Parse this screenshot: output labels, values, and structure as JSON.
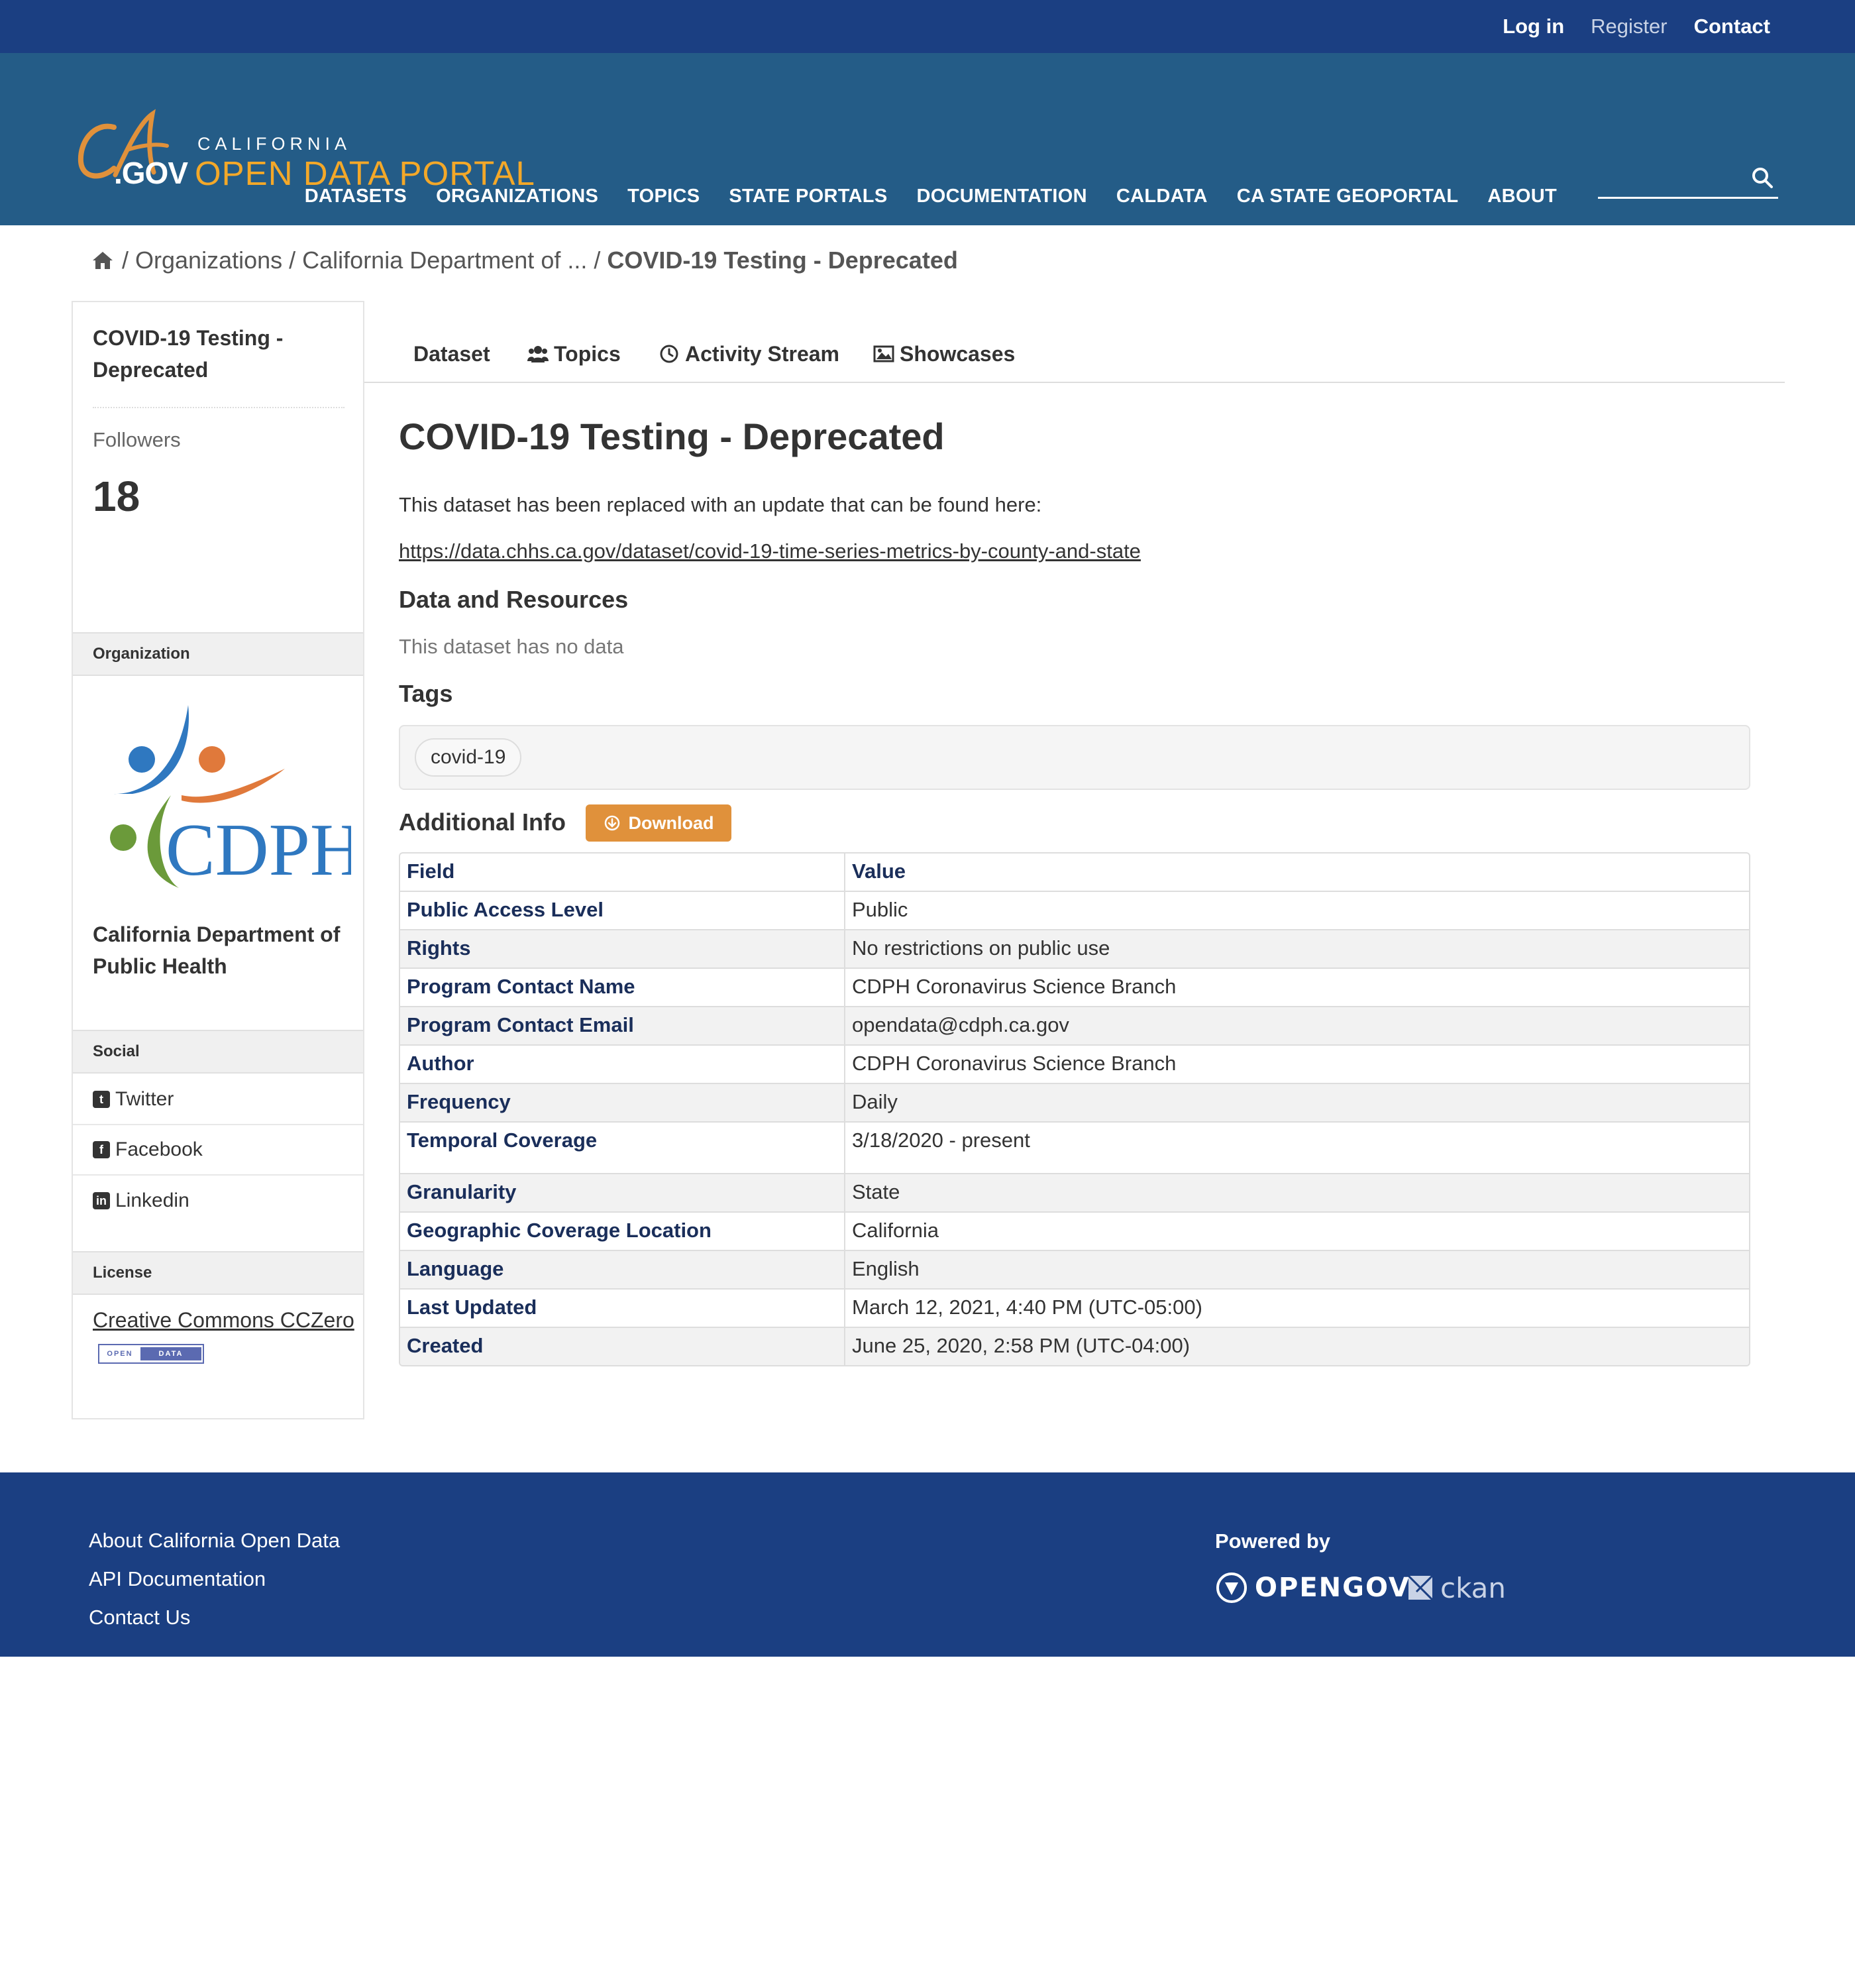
{
  "account": {
    "login": "Log in",
    "register": "Register",
    "contact": "Contact"
  },
  "logo": {
    "gov": ".GOV",
    "state": "CALIFORNIA",
    "portal": "OPEN DATA PORTAL"
  },
  "nav": {
    "items": [
      "DATASETS",
      "ORGANIZATIONS",
      "TOPICS",
      "STATE PORTALS",
      "DOCUMENTATION",
      "CALDATA",
      "CA STATE GEOPORTAL",
      "ABOUT"
    ],
    "search_placeholder": "",
    "search_icon": "search-icon"
  },
  "breadcrumb": {
    "items": [
      "Organizations",
      "California Department of ..."
    ],
    "current": "COVID-19 Testing - Deprecated"
  },
  "sidebar": {
    "title": "COVID-19 Testing - Deprecated",
    "followers_label": "Followers",
    "followers_count": "18",
    "organization_heading": "Organization",
    "organization_name": "California Department of Public Health",
    "social_heading": "Social",
    "social": [
      "Twitter",
      "Facebook",
      "Linkedin"
    ],
    "license_heading": "License",
    "license_text": "Creative Commons CCZero",
    "badge_left": "OPEN",
    "badge_right": "DATA"
  },
  "tabs": [
    "Dataset",
    "Topics",
    "Activity Stream",
    "Showcases"
  ],
  "dataset": {
    "title": "COVID-19 Testing - Deprecated",
    "notes": "This dataset has been replaced with an update that can be found here:",
    "link": "https://data.chhs.ca.gov/dataset/covid-19-time-series-metrics-by-county-and-state",
    "resources_heading": "Data and Resources",
    "no_data": "This dataset has no data",
    "tags_heading": "Tags",
    "tags": [
      "covid-19"
    ],
    "additional_heading": "Additional Info",
    "download_label": "Download"
  },
  "info_table": {
    "header": [
      "Field",
      "Value"
    ],
    "rows": [
      [
        "Public Access Level",
        "Public"
      ],
      [
        "Rights",
        "No restrictions on public use"
      ],
      [
        "Program Contact Name",
        "CDPH Coronavirus Science Branch"
      ],
      [
        "Program Contact Email",
        "opendata@cdph.ca.gov"
      ],
      [
        "Author",
        "CDPH Coronavirus Science Branch"
      ],
      [
        "Frequency",
        "Daily"
      ],
      [
        "Temporal Coverage",
        "3/18/2020 - present"
      ],
      [
        "Granularity",
        "State"
      ],
      [
        "Geographic Coverage Location",
        "California"
      ],
      [
        "Language",
        "English"
      ],
      [
        "Last Updated",
        "March 12, 2021, 4:40 PM (UTC-05:00)"
      ],
      [
        "Created",
        "June 25, 2020, 2:58 PM (UTC-04:00)"
      ]
    ]
  },
  "footer": {
    "links": [
      "About California Open Data",
      "API Documentation",
      "Contact Us"
    ],
    "powered_by": "Powered by",
    "opengov": "OPENGOV",
    "ckan": "ckan"
  },
  "colors": {
    "top_bar": "#1b3f82",
    "masthead": "#245c87",
    "accent_orange": "#e0913b",
    "portal_gold": "#f3a829"
  }
}
